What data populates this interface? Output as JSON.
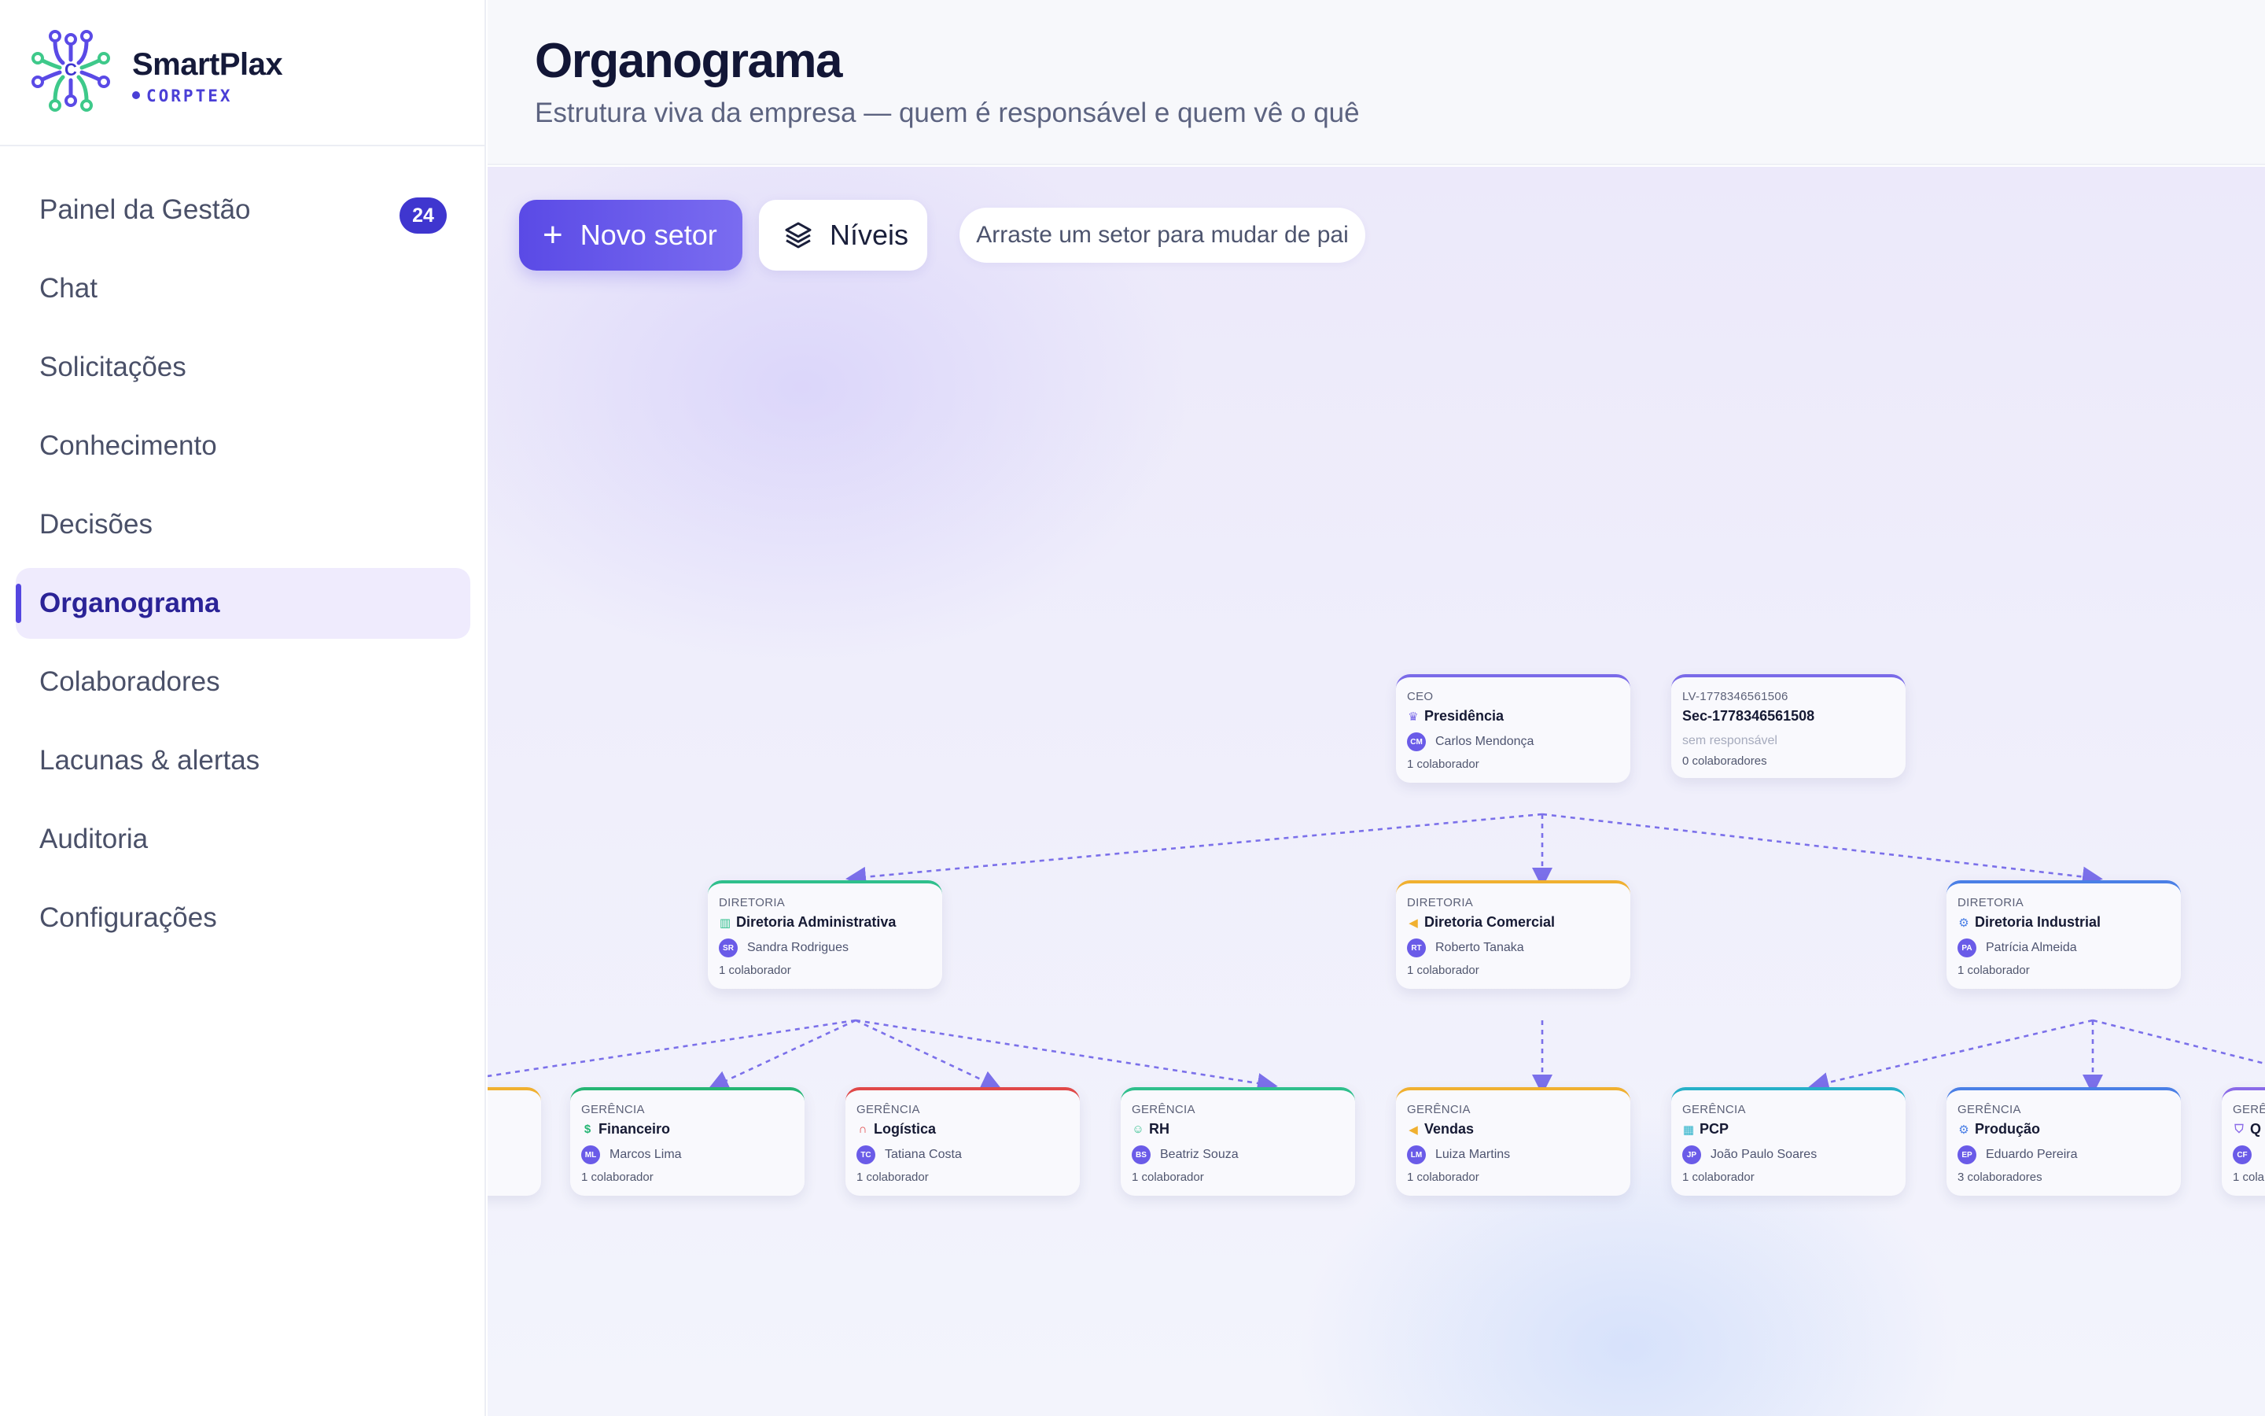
{
  "brand": {
    "name": "SmartPlax",
    "sub": "CORPTEX",
    "logo_letter": "C"
  },
  "nav": {
    "items": [
      {
        "label": "Painel da Gestão",
        "badge": "24"
      },
      {
        "label": "Chat"
      },
      {
        "label": "Solicitações"
      },
      {
        "label": "Conhecimento"
      },
      {
        "label": "Decisões"
      },
      {
        "label": "Organograma",
        "active": true
      },
      {
        "label": "Colaboradores"
      },
      {
        "label": "Lacunas & alertas"
      },
      {
        "label": "Auditoria"
      },
      {
        "label": "Configurações"
      }
    ]
  },
  "header": {
    "title": "Organograma",
    "subtitle": "Estrutura viva da empresa — quem é responsável e quem vê o quê"
  },
  "toolbar": {
    "new_sector": "Novo setor",
    "levels": "Níveis",
    "hint": "Arraste um setor para mudar de pai"
  },
  "colors": {
    "accent": "#5446e0",
    "ceo": "#7a6ae8",
    "admin": "#2fbf8c",
    "comercial": "#f0b030",
    "industrial": "#4a7fe6",
    "financeiro": "#25b574",
    "logistica": "#e04848",
    "rh": "#2fbf8c",
    "pcp": "#26b0c8",
    "producao": "#4a7fe6",
    "qualidade": "#8a6ae8"
  },
  "nodes": {
    "presidencia": {
      "level": "CEO",
      "name": "Presidência",
      "icon": "crown-icon",
      "owner": "Carlos Mendonça",
      "initials": "CM",
      "count": "1 colaborador"
    },
    "sec": {
      "level": "LV-1778346561506",
      "name": "Sec-1778346561508",
      "owner_none": "sem responsável",
      "count": "0 colaboradores"
    },
    "dir_admin": {
      "level": "DIRETORIA",
      "name": "Diretoria Administrativa",
      "icon": "building-icon",
      "owner": "Sandra Rodrigues",
      "initials": "SR",
      "count": "1 colaborador"
    },
    "dir_comercial": {
      "level": "DIRETORIA",
      "name": "Diretoria Comercial",
      "icon": "megaphone-icon",
      "owner": "Roberto Tanaka",
      "initials": "RT",
      "count": "1 colaborador"
    },
    "dir_industrial": {
      "level": "DIRETORIA",
      "name": "Diretoria Industrial",
      "icon": "cog-icon",
      "owner": "Patrícia Almeida",
      "initials": "PA",
      "count": "1 colaborador"
    },
    "financeiro": {
      "level": "GERÊNCIA",
      "name": "Financeiro",
      "icon": "dollar-icon",
      "owner": "Marcos Lima",
      "initials": "ML",
      "count": "1 colaborador"
    },
    "logistica": {
      "level": "GERÊNCIA",
      "name": "Logística",
      "icon": "headset-icon",
      "owner": "Tatiana Costa",
      "initials": "TC",
      "count": "1 colaborador"
    },
    "rh": {
      "level": "GERÊNCIA",
      "name": "RH",
      "icon": "users-icon",
      "owner": "Beatriz Souza",
      "initials": "BS",
      "count": "1 colaborador"
    },
    "vendas": {
      "level": "GERÊNCIA",
      "name": "Vendas",
      "icon": "megaphone-icon",
      "owner": "Luiza Martins",
      "initials": "LM",
      "count": "1 colaborador"
    },
    "pcp": {
      "level": "GERÊNCIA",
      "name": "PCP",
      "icon": "factory-icon",
      "owner": "João Paulo Soares",
      "initials": "JP",
      "count": "1 colaborador"
    },
    "producao": {
      "level": "GERÊNCIA",
      "name": "Produção",
      "icon": "cog-icon",
      "owner": "Eduardo Pereira",
      "initials": "EP",
      "count": "3 colaboradores"
    },
    "qualidade_partial": {
      "level": "GERÊ",
      "name": "Q",
      "icon": "shield-icon",
      "initials": "CF",
      "count": "1 cola"
    }
  }
}
